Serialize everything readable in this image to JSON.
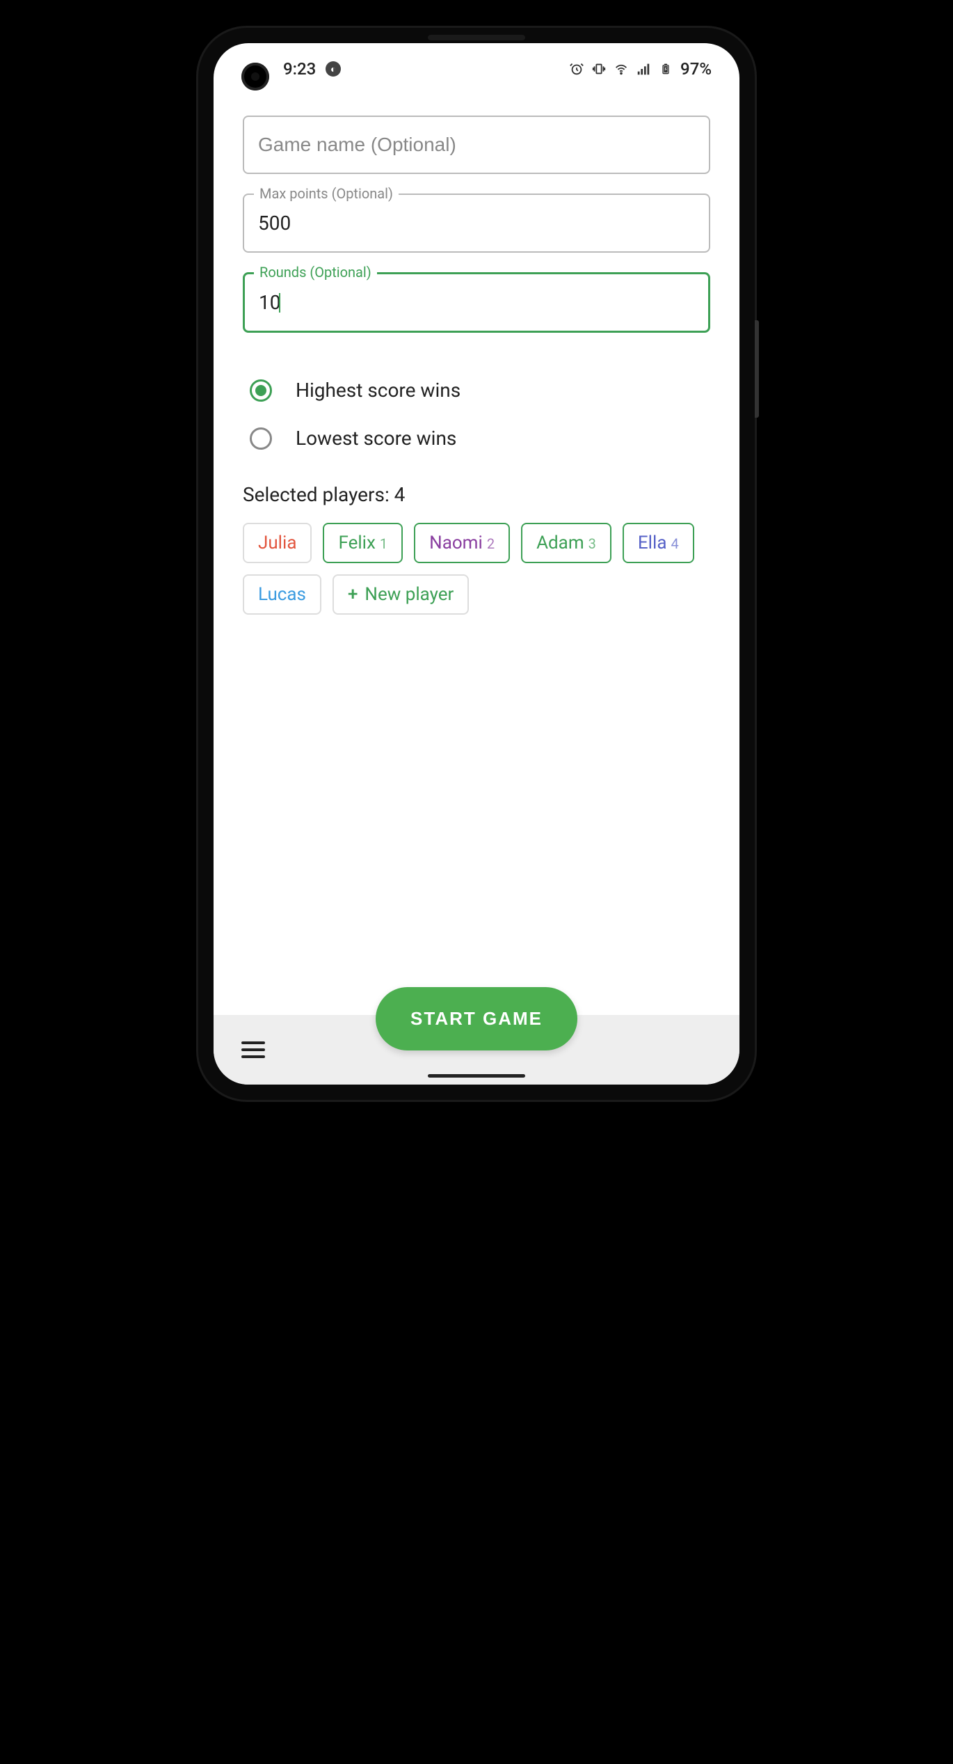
{
  "status": {
    "time": "9:23",
    "battery": "97%"
  },
  "form": {
    "game_name": {
      "label": "Game name (Optional)",
      "value": ""
    },
    "max_points": {
      "label": "Max points (Optional)",
      "value": "500"
    },
    "rounds": {
      "label": "Rounds (Optional)",
      "value": "10"
    }
  },
  "win_mode": {
    "highest": "Highest score wins",
    "lowest": "Lowest score wins",
    "selected": "highest"
  },
  "players": {
    "header_prefix": "Selected players: ",
    "count": "4",
    "list": [
      {
        "name": "Julia",
        "color": "#e2553e",
        "selected": false,
        "sub": ""
      },
      {
        "name": "Felix",
        "color": "#3da055",
        "selected": true,
        "sub": "1"
      },
      {
        "name": "Naomi",
        "color": "#8a3fa0",
        "selected": true,
        "sub": "2"
      },
      {
        "name": "Adam",
        "color": "#3da055",
        "selected": true,
        "sub": "3"
      },
      {
        "name": "Ella",
        "color": "#5560c7",
        "selected": true,
        "sub": "4"
      },
      {
        "name": "Lucas",
        "color": "#3a9be0",
        "selected": false,
        "sub": ""
      }
    ],
    "new_label": "New player"
  },
  "actions": {
    "start": "START GAME"
  }
}
